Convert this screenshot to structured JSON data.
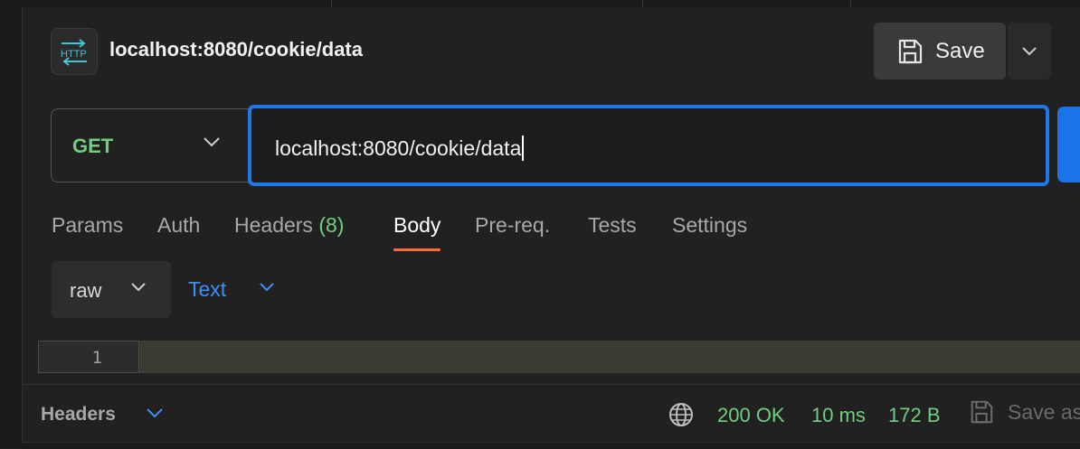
{
  "request": {
    "icon_label": "HTTP",
    "title": "localhost:8080/cookie/data",
    "method": "GET",
    "url": "localhost:8080/cookie/data"
  },
  "toolbar": {
    "save_label": "Save"
  },
  "tabs": [
    {
      "label": "Params"
    },
    {
      "label": "Auth"
    },
    {
      "label": "Headers",
      "count": "(8)"
    },
    {
      "label": "Body",
      "active": true
    },
    {
      "label": "Pre-req."
    },
    {
      "label": "Tests"
    },
    {
      "label": "Settings"
    }
  ],
  "body": {
    "mode": "raw",
    "format": "Text",
    "line_numbers": [
      "1"
    ]
  },
  "response": {
    "section_title": "Headers",
    "status": "200 OK",
    "time": "10 ms",
    "size": "172 B",
    "save_label": "Save as"
  },
  "colors": {
    "method_get": "#6fcf7f",
    "focus_border": "#1f78e6",
    "active_tab_underline": "#ff6c37",
    "link_blue": "#3d8ff5",
    "status_green": "#6fcf7f"
  }
}
